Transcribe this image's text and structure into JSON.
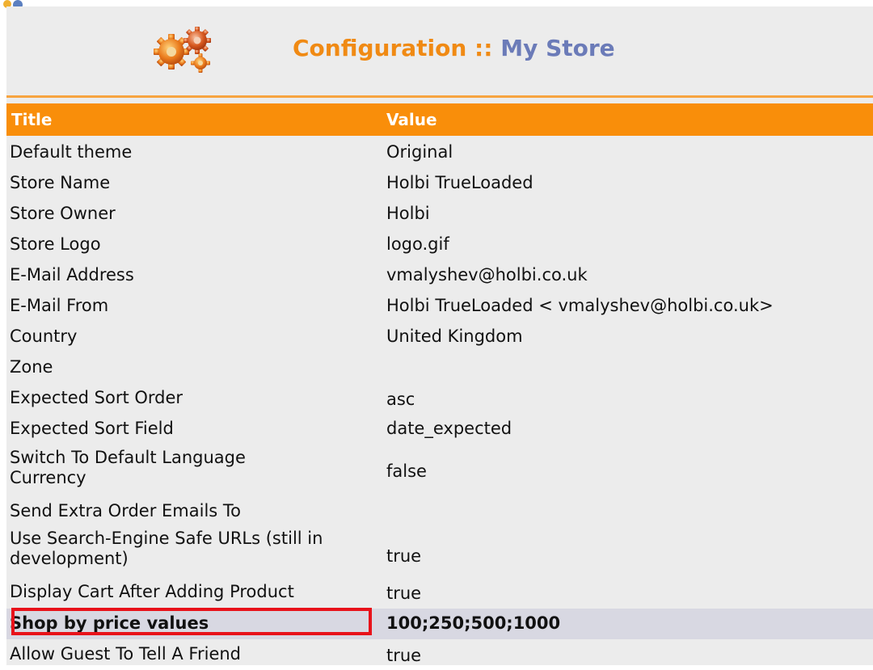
{
  "header": {
    "icon": "gears-icon",
    "title_main": "Configuration",
    "title_sep": " :: ",
    "title_store": "My Store"
  },
  "colors": {
    "accent": "#f98e0a",
    "title_orange": "#f08a14",
    "title_blue": "#6b7bb8",
    "highlight_border": "#e8121a"
  },
  "table": {
    "columns": [
      "Title",
      "Value"
    ],
    "rows": [
      {
        "title": "Default theme",
        "value": "Original"
      },
      {
        "title": "Store Name",
        "value": "Holbi TrueLoaded"
      },
      {
        "title": "Store Owner",
        "value": "Holbi"
      },
      {
        "title": "Store Logo",
        "value": "logo.gif"
      },
      {
        "title": "E-Mail Address",
        "value": "vmalyshev@holbi.co.uk"
      },
      {
        "title": "E-Mail From",
        "value": "Holbi TrueLoaded < vmalyshev@holbi.co.uk>"
      },
      {
        "title": "Country",
        "value": "United Kingdom"
      },
      {
        "title": "Zone",
        "value": ""
      },
      {
        "title": "Expected Sort Order",
        "value": "asc"
      },
      {
        "title": "Expected Sort Field",
        "value": "date_expected"
      },
      {
        "title": "Switch To Default Language Currency",
        "value": "false"
      },
      {
        "title": "Send Extra Order Emails To",
        "value": ""
      },
      {
        "title": "Use Search-Engine Safe URLs (still in development)",
        "value": "true"
      },
      {
        "title": "Display Cart After Adding Product",
        "value": "true"
      },
      {
        "title": "Shop by price values",
        "value": "100;250;500;1000"
      },
      {
        "title": "Allow Guest To Tell A Friend",
        "value": "true"
      }
    ]
  }
}
